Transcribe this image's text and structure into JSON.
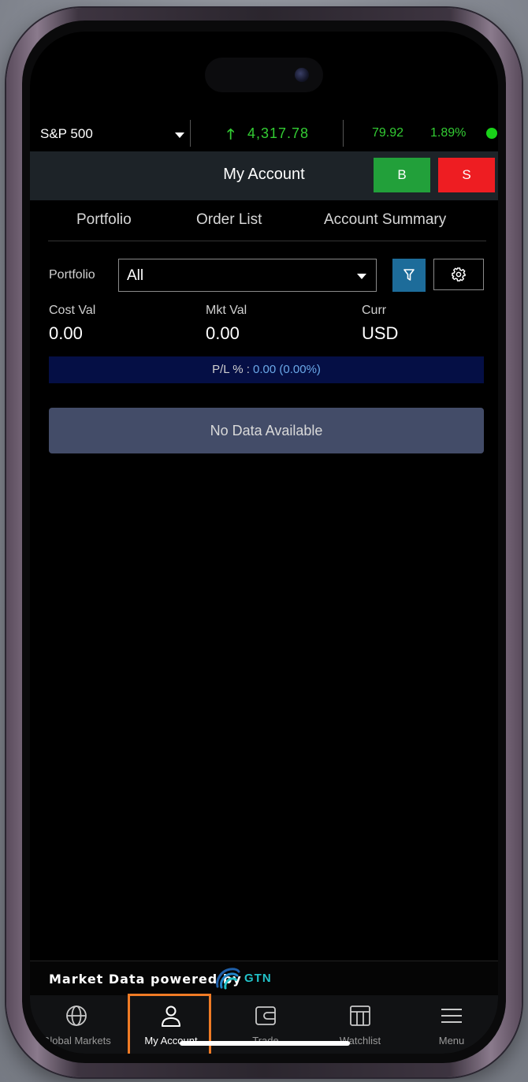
{
  "ticker": {
    "index_name": "S&P 500",
    "price": "4,317.78",
    "change": "79.92",
    "change_pct": "1.89%",
    "trend": "up",
    "status_color": "#19d219"
  },
  "header": {
    "title": "My Account",
    "buy_label": "B",
    "sell_label": "S"
  },
  "tabs": [
    {
      "label": "Portfolio"
    },
    {
      "label": "Order List"
    },
    {
      "label": "Account Summary"
    }
  ],
  "filters": {
    "portfolio_label": "Portfolio",
    "portfolio_value": "All",
    "filter_icon": "filter-icon",
    "settings_icon": "gear-icon"
  },
  "summary": {
    "cost_label": "Cost Val",
    "cost_value": "0.00",
    "mkt_label": "Mkt Val",
    "mkt_value": "0.00",
    "curr_label": "Curr",
    "curr_value": "USD",
    "pl_label": "P/L % :",
    "pl_value": "0.00 (0.00%)"
  },
  "empty_message": "No Data Available",
  "footer": {
    "powered_text": "Market Data powered by",
    "brand": "GTN"
  },
  "nav": [
    {
      "label": "Global Markets",
      "icon": "globe-icon"
    },
    {
      "label": "My Account",
      "icon": "user-icon",
      "active": true
    },
    {
      "label": "Trade",
      "icon": "wallet-icon"
    },
    {
      "label": "Watchlist",
      "icon": "watchlist-icon"
    },
    {
      "label": "Menu",
      "icon": "menu-icon"
    }
  ],
  "colors": {
    "up": "#33cc33",
    "buy": "#22a03a",
    "sell": "#ee1d22",
    "highlight": "#f07b25",
    "filter": "#1d6c9a"
  }
}
